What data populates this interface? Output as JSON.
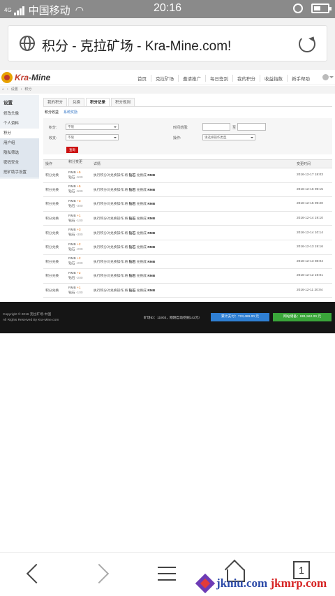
{
  "statusbar": {
    "signal": "4G",
    "carrier": "中国移动",
    "time": "20:16"
  },
  "browser": {
    "url_title": "积分 - 克拉矿场 - Kra-Mine.com!"
  },
  "site": {
    "logo_kra": "Kra",
    "logo_mine": "-Mine",
    "nav": [
      "首页",
      "克拉矿场",
      "邀请推广",
      "每日签到",
      "我的积分",
      "收益指数",
      "新手帮助"
    ],
    "breadcrumb": [
      "⌂",
      "设置",
      "积分"
    ]
  },
  "sidebar": {
    "title": "设置",
    "items": [
      "修改头像",
      "个人资料",
      "积分",
      "用户组",
      "隐私筛选",
      "密码安全",
      "挖矿助手设置"
    ]
  },
  "tabs": [
    "我的积分",
    "兑换",
    "积分记录",
    "积分规则"
  ],
  "subtabs": {
    "active": "积分收益",
    "other": "系统奖励"
  },
  "filter": {
    "points_label": "积分:",
    "points_value": "不限",
    "income_label": "收支:",
    "income_value": "不限",
    "time_label": "时间范围:",
    "time_sep": "至",
    "op_label": "操作:",
    "op_value": "请选择操作类型",
    "query": "查询"
  },
  "table": {
    "headers": [
      "操作",
      "积分变更",
      "详情",
      "变更时间"
    ],
    "rows": [
      {
        "op": "积分兑换",
        "c1": "RMB",
        "v1": "+5",
        "c2": "钻石",
        "v2": "-500",
        "detail_pre": "执行积分对兑换操作,将 ",
        "from": "钻石",
        "mid": " 兑换成 ",
        "to": "RMB",
        "time": "2016-12-17 18:03"
      },
      {
        "op": "积分兑换",
        "c1": "RMB",
        "v1": "+5",
        "c2": "钻石",
        "v2": "-500",
        "detail_pre": "执行积分对兑换操作,将 ",
        "from": "钻石",
        "mid": " 兑换成 ",
        "to": "RMB",
        "time": "2016-12-16 09:15"
      },
      {
        "op": "积分兑换",
        "c1": "RMB",
        "v1": "+3",
        "c2": "钻石",
        "v2": "-300",
        "detail_pre": "执行积分对兑换操作,将 ",
        "from": "钻石",
        "mid": " 兑换成 ",
        "to": "RMB",
        "time": "2016-12-15 09:20"
      },
      {
        "op": "积分兑换",
        "c1": "RMB",
        "v1": "+1",
        "c2": "钻石",
        "v2": "-100",
        "detail_pre": "执行积分对兑换操作,将 ",
        "from": "钻石",
        "mid": " 兑换成 ",
        "to": "RMB",
        "time": "2016-12-14 19:10"
      },
      {
        "op": "积分兑换",
        "c1": "RMB",
        "v1": "+3",
        "c2": "钻石",
        "v2": "-300",
        "detail_pre": "执行积分对兑换操作,将 ",
        "from": "钻石",
        "mid": " 兑换成 ",
        "to": "RMB",
        "time": "2016-12-14 10:14"
      },
      {
        "op": "积分兑换",
        "c1": "RMB",
        "v1": "+2",
        "c2": "钻石",
        "v2": "-200",
        "detail_pre": "执行积分对兑换操作,将 ",
        "from": "钻石",
        "mid": " 兑换成 ",
        "to": "RMB",
        "time": "2016-12-13 19:16"
      },
      {
        "op": "积分兑换",
        "c1": "RMB",
        "v1": "+2",
        "c2": "钻石",
        "v2": "-200",
        "detail_pre": "执行积分对兑换操作,将 ",
        "from": "钻石",
        "mid": " 兑换成 ",
        "to": "RMB",
        "time": "2016-12-13 08:04"
      },
      {
        "op": "积分兑换",
        "c1": "RMB",
        "v1": "+2",
        "c2": "钻石",
        "v2": "-200",
        "detail_pre": "执行积分对兑换操作,将 ",
        "from": "钻石",
        "mid": " 兑换成 ",
        "to": "RMB",
        "time": "2016-12-12 19:01"
      },
      {
        "op": "积分兑换",
        "c1": "RMB",
        "v1": "+1",
        "c2": "钻石",
        "v2": "-100",
        "detail_pre": "执行积分对兑换操作,将 ",
        "from": "钻石",
        "mid": " 兑换成 ",
        "to": "RMB",
        "time": "2016-12-11 20:04"
      }
    ]
  },
  "footer": {
    "copyright": "Copyright © 2016 克拉矿场-中国",
    "rights": "All Rights Reserved By  Kra-Mine.com",
    "mine_info": "矿场ID：11903，刚刚自动挖掘142元!",
    "paid": "累计支付：723,489.00 元",
    "reserve": "网站储备：881,562.00 元"
  },
  "toolbar": {
    "tab_count": "1"
  },
  "watermark": {
    "a": "jkniu.com",
    "b": "jkmrp.com"
  }
}
